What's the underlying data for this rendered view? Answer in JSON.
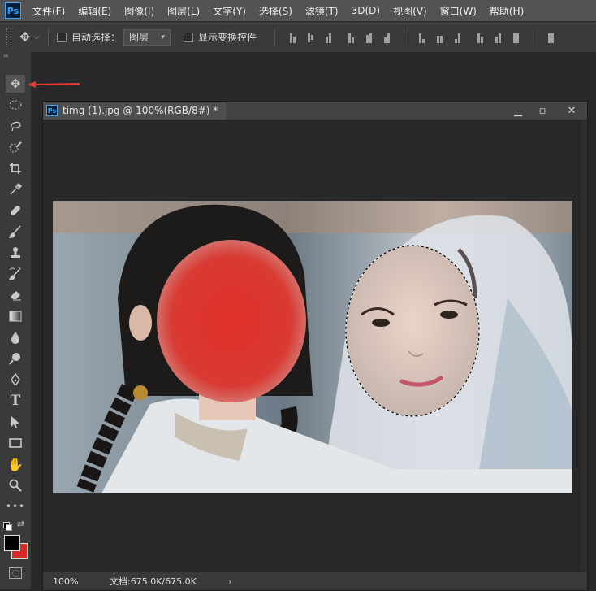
{
  "app": {
    "logo": "Ps"
  },
  "menu": [
    "文件(F)",
    "编辑(E)",
    "图像(I)",
    "图层(L)",
    "文字(Y)",
    "选择(S)",
    "滤镜(T)",
    "3D(D)",
    "视图(V)",
    "窗口(W)",
    "帮助(H)"
  ],
  "options": {
    "auto_select_label": "自动选择：",
    "auto_select_value": "图层",
    "show_transform_label": "显示变换控件"
  },
  "tools": [
    "move-tool",
    "elliptical-marquee-tool",
    "lasso-tool",
    "quick-selection-tool",
    "crop-tool",
    "eyedropper-tool",
    "healing-brush-tool",
    "brush-tool",
    "clone-stamp-tool",
    "history-brush-tool",
    "eraser-tool",
    "gradient-tool",
    "blur-tool",
    "dodge-tool",
    "pen-tool",
    "type-tool",
    "path-selection-tool",
    "rectangle-tool",
    "hand-tool",
    "zoom-tool",
    "more-tools"
  ],
  "document": {
    "tab_title": "timg (1).jpg @ 100%(RGB/8#) *",
    "zoom": "100%",
    "doc_info": "文档:675.0K/675.0K"
  },
  "colors": {
    "foreground": "#000000",
    "background": "#d42a2a",
    "accent": "#31a8ff",
    "annotation_arrow": "#e53935"
  }
}
